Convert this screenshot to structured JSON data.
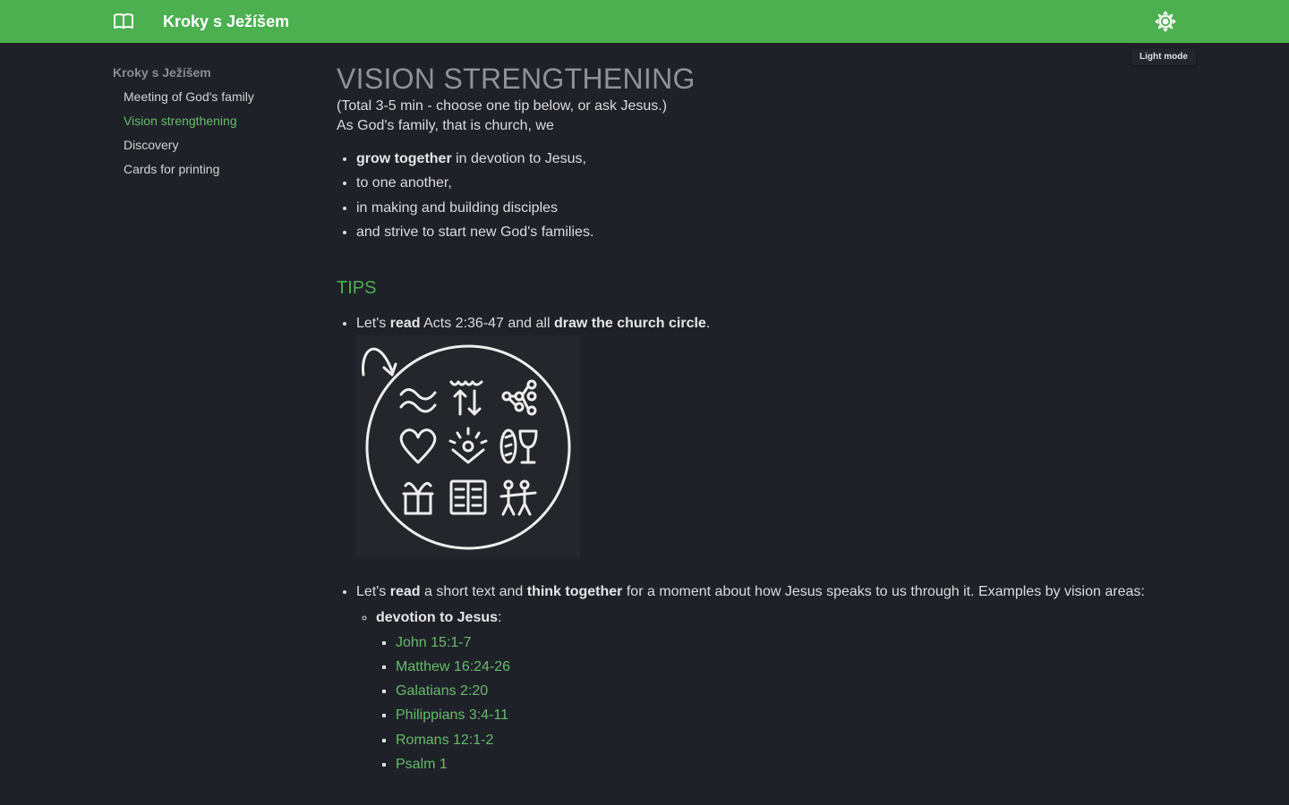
{
  "header": {
    "title": "Kroky s Ježíšem",
    "menu_icon": "book-icon",
    "theme_icon": "sun-icon",
    "theme_tooltip": "Light mode",
    "accent": "#4caf50"
  },
  "sidebar": {
    "heading": "Kroky s Ježíšem",
    "items": [
      {
        "label": "Meeting of God's family",
        "active": false
      },
      {
        "label": "Vision strengthening",
        "active": true
      },
      {
        "label": "Discovery",
        "active": false
      },
      {
        "label": "Cards for printing",
        "active": false
      }
    ]
  },
  "main": {
    "title": "VISION STRENGTHENING",
    "intro": "(Total 3-5 min - choose one tip below, or ask Jesus.)",
    "lead": "As God's family, that is church, we",
    "vision_points": [
      {
        "bold": "grow together",
        "text": " in devotion to Jesus,"
      },
      {
        "text": "to one another,"
      },
      {
        "text": "in making and building disciples"
      },
      {
        "text": "and strive to start new God's families."
      }
    ],
    "tips_heading": "TIPS",
    "tip1": {
      "t1": "Let's ",
      "b1": "read",
      "t2": " Acts 2:36-47 and all ",
      "b2": "draw the church circle",
      "t3": "."
    },
    "tip2": {
      "t1": "Let's ",
      "b1": "read",
      "t2": " a short text and ",
      "b2": "think together",
      "t3": " for a moment about how Jesus speaks to us through it. Examples by vision areas:"
    },
    "area": {
      "name": "devotion to Jesus",
      "suffix": ":",
      "refs": [
        "John 15:1-7",
        "Matthew 16:24-26",
        "Galatians 2:20",
        "Philippians 3:4-11",
        "Romans 12:1-2",
        "Psalm 1"
      ]
    }
  }
}
